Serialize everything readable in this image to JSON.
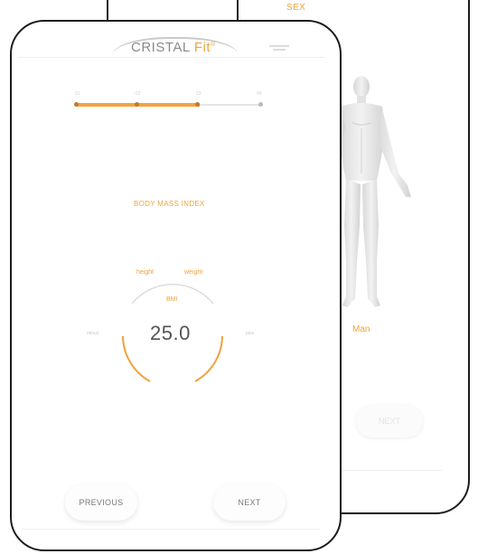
{
  "background_screen": {
    "section_label": "SEX",
    "selected_option": "Man",
    "next_label": "NEXT"
  },
  "header": {
    "brand_main": "CRISTAL ",
    "brand_accent": "Fit",
    "brand_mark": "®"
  },
  "progress": {
    "steps": [
      "01",
      "02",
      "03",
      "04"
    ],
    "current_step": 3,
    "total_steps": 4
  },
  "bmi": {
    "section_title": "BODY MASS INDEX",
    "height_label": "height",
    "weight_label": "weight",
    "gauge_label": "BMI",
    "value": "25.0",
    "left_side_label": "minus",
    "right_side_label": "plus"
  },
  "navigation": {
    "previous_label": "PREVIOUS",
    "next_label": "NEXT"
  },
  "colors": {
    "accent": "#f0a23a",
    "frame": "#1c1c1c",
    "text": "#555555"
  }
}
